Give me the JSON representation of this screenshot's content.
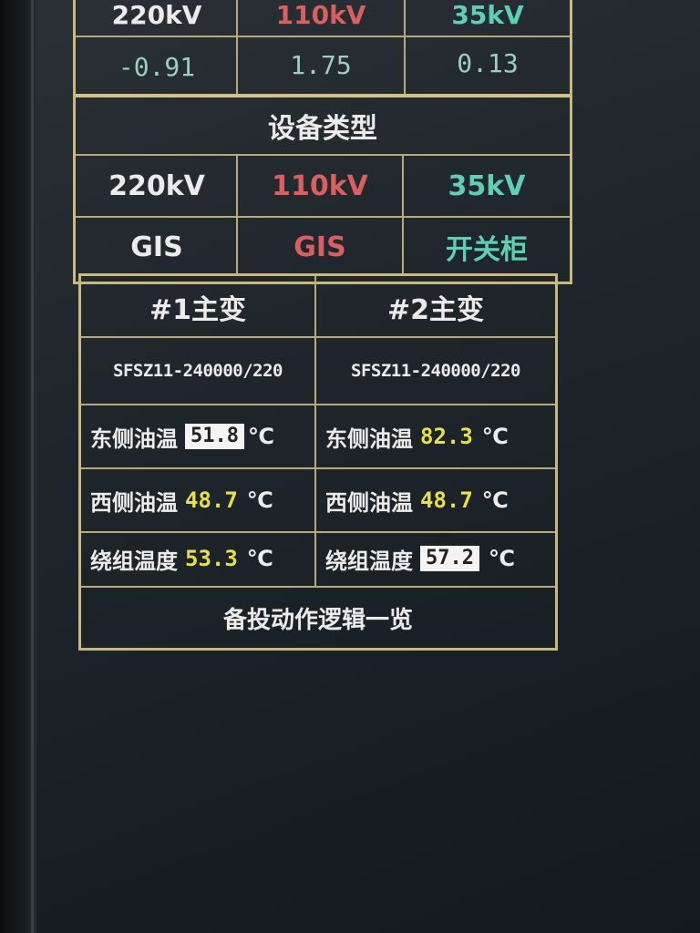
{
  "bus_table": {
    "headers": [
      "220kV",
      "110kV",
      "35kV"
    ],
    "values": [
      "-0.91",
      "1.75",
      "0.13"
    ]
  },
  "equipment": {
    "title": "设备类型",
    "voltages": [
      "220kV",
      "110kV",
      "35kV"
    ],
    "types": [
      "GIS",
      "GIS",
      "开关柜"
    ]
  },
  "transformers": [
    {
      "title": "#1主变",
      "model": "SFSZ11-240000/220",
      "east_oil_label": "东侧油温",
      "east_oil_value": "51.8",
      "west_oil_label": "西侧油温",
      "west_oil_value": "48.7",
      "winding_label": "绕组温度",
      "winding_value": "53.3",
      "unit": "℃"
    },
    {
      "title": "#2主变",
      "model": "SFSZ11-240000/220",
      "east_oil_label": "东侧油温",
      "east_oil_value": "82.3",
      "west_oil_label": "西侧油温",
      "west_oil_value": "48.7",
      "winding_label": "绕组温度",
      "winding_value": "57.2",
      "unit": "℃"
    }
  ],
  "footer_link": "备投动作逻辑一览",
  "colors": {
    "border": "#c9b97c",
    "value_yellow": "#e8e04a",
    "red": "#d9605f",
    "teal": "#5ecfb5"
  }
}
